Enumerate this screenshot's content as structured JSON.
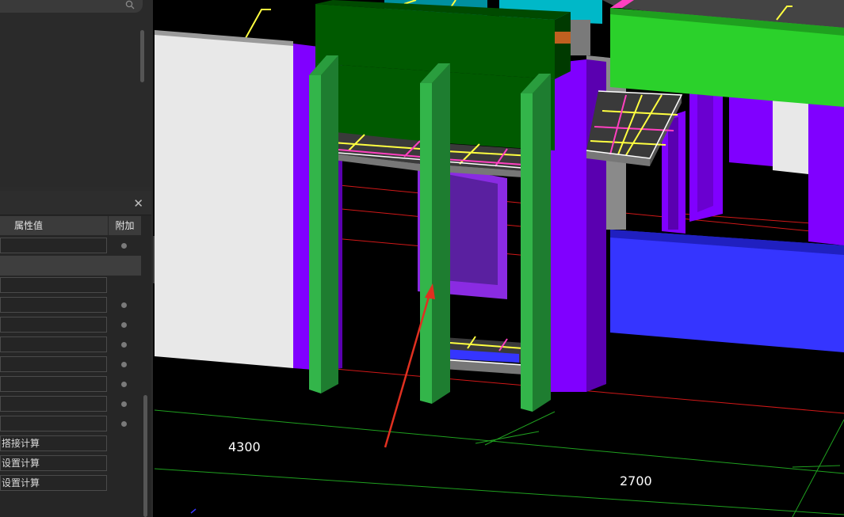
{
  "properties_panel": {
    "header_col_value": "属性值",
    "header_col_extra": "附加",
    "rows": [
      {
        "value": "",
        "dot": true
      },
      {
        "value": "",
        "dot": false,
        "selected": true
      },
      {
        "value": "",
        "dot": false
      },
      {
        "value": "",
        "dot": true
      },
      {
        "value": "",
        "dot": true
      },
      {
        "value": "",
        "dot": true
      },
      {
        "value": "",
        "dot": true
      },
      {
        "value": "",
        "dot": true
      },
      {
        "value": "",
        "dot": true
      },
      {
        "value": "",
        "dot": true
      },
      {
        "value": "搭接计算",
        "dot": false
      },
      {
        "value": "设置计算",
        "dot": false
      },
      {
        "value": "设置计算",
        "dot": false
      }
    ]
  },
  "viewport": {
    "dimension_labels": [
      "4300",
      "2700"
    ]
  },
  "icons": {
    "search": "search-icon",
    "close": "close-icon",
    "collapse": "chevron-left-icon"
  },
  "colors": {
    "column_green": "#33b54a",
    "beam_dark_green": "#005a00",
    "beam_light_green": "#2bd12b",
    "wall_purple": "#8000ff",
    "beam_blue": "#3535ff",
    "wall_white": "#e8e8e8",
    "pointer_arrow": "#e03020"
  }
}
